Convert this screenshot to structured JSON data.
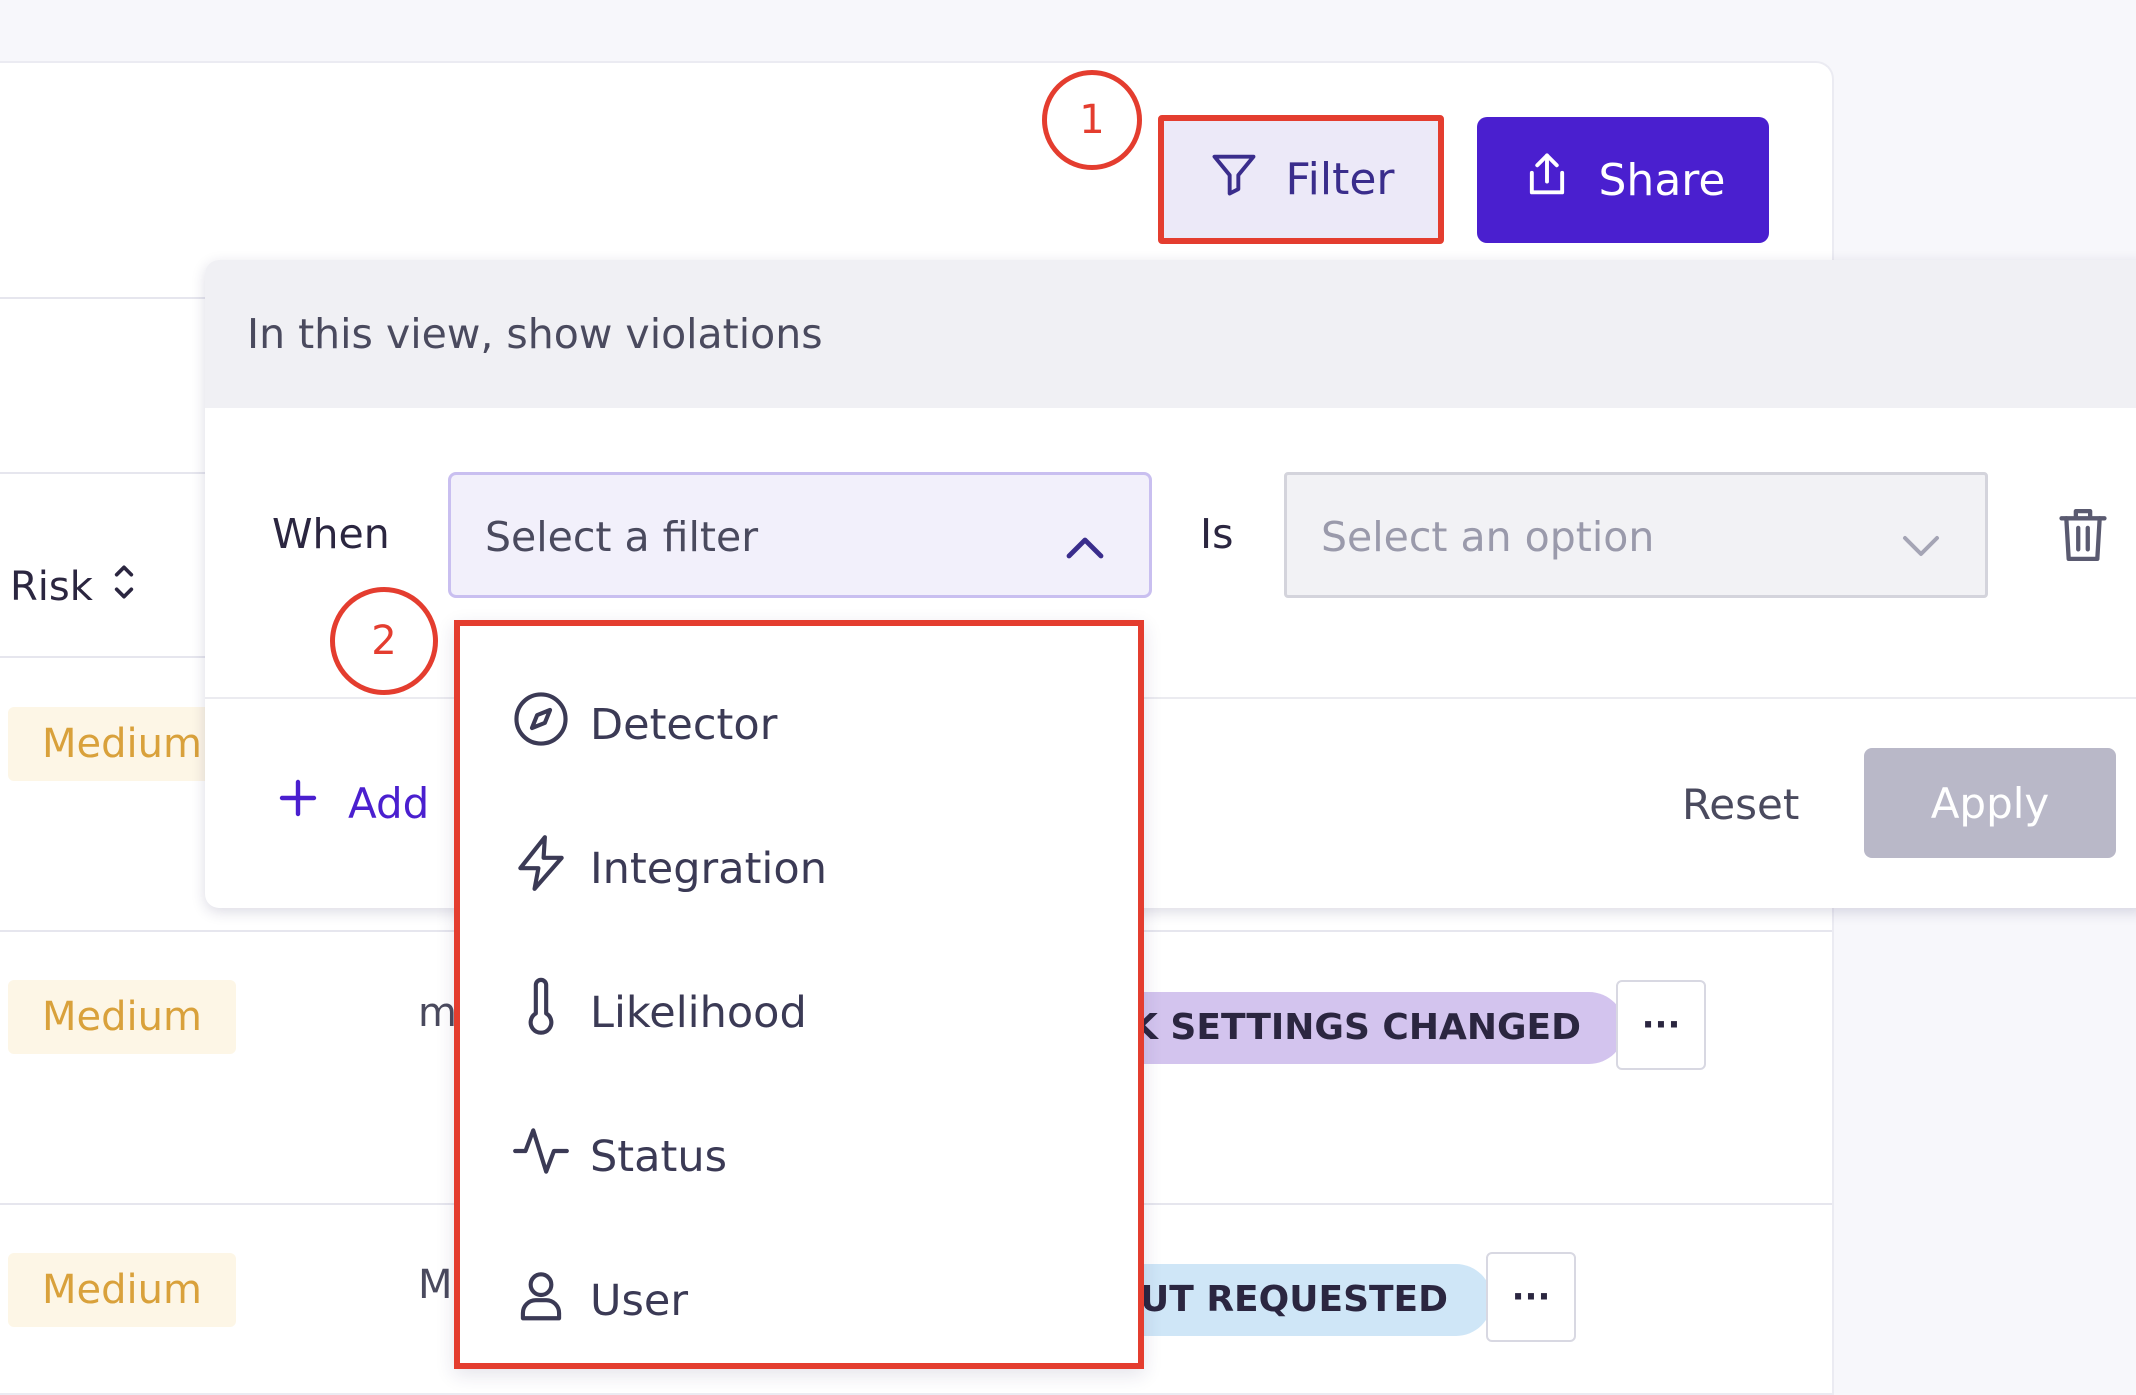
{
  "toolbar": {
    "filter_label": "Filter",
    "share_label": "Share"
  },
  "callouts": {
    "first": "1",
    "second": "2"
  },
  "table": {
    "risk_header": "Risk",
    "rows": [
      {
        "risk": "Medium",
        "text": "",
        "tag": "",
        "tag_color": ""
      },
      {
        "risk": "Medium",
        "text": "m",
        "tag": "K SETTINGS CHANGED",
        "tag_color": "#d3c4ee"
      },
      {
        "risk": "Medium",
        "text": "M",
        "tag": "UT REQUESTED",
        "tag_color": "#cfe6f7"
      }
    ],
    "more_label": "···"
  },
  "filter_panel": {
    "heading": "In this view, show violations",
    "when_label": "When",
    "filter_placeholder": "Select a filter",
    "is_label": "Is",
    "option_placeholder": "Select an option",
    "add_label": "Add",
    "reset_label": "Reset",
    "apply_label": "Apply"
  },
  "filter_options": [
    {
      "label": "Detector",
      "icon": "compass-icon"
    },
    {
      "label": "Integration",
      "icon": "lightning-icon"
    },
    {
      "label": "Likelihood",
      "icon": "thermometer-icon"
    },
    {
      "label": "Status",
      "icon": "activity-icon"
    },
    {
      "label": "User",
      "icon": "user-icon"
    }
  ],
  "colors": {
    "accent": "#4a1fcf",
    "highlight": "#e43d2f",
    "medium_badge_text": "#d9a13b",
    "medium_badge_bg": "#fdf6e6"
  }
}
